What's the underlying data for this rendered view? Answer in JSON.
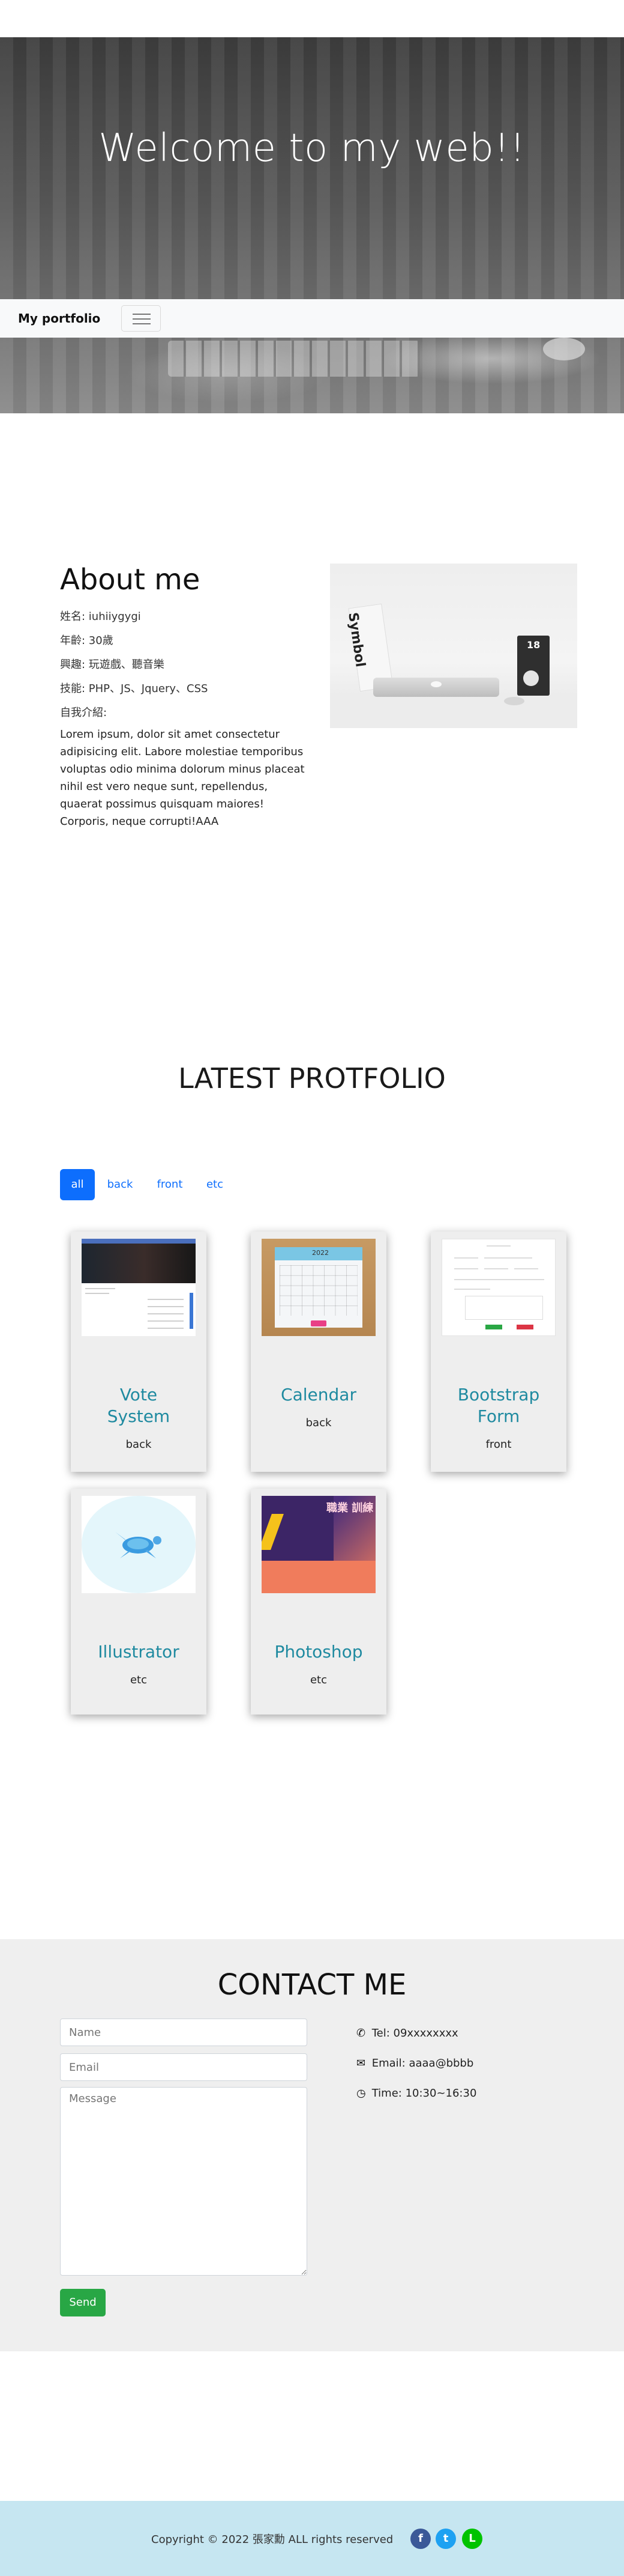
{
  "hero": {
    "title": "Welcome to my web!!"
  },
  "navbar": {
    "brand": "My portfolio"
  },
  "about": {
    "title": "About me",
    "info": [
      "姓名: iuhiiygygi",
      "年齡: 30歲",
      "興趣: 玩遊戲、聽音樂",
      "技能: PHP、JS、Jquery、CSS",
      "自我介紹:"
    ],
    "intro": "Lorem ipsum, dolor sit amet consectetur adipisicing elit. Labore molestiae temporibus voluptas odio minima dolorum minus placeat nihil est vero neque sunt, repellendus, quaerat possimus quisquam maiores! Corporis, neque corrupti!AAA",
    "photo_text_1": "Symbol",
    "photo_text_2": "18"
  },
  "portfolio": {
    "title": "LATEST PROTFOLIO",
    "filters": [
      "all",
      "back",
      "front",
      "etc"
    ],
    "active_filter": "all",
    "cards": [
      {
        "title_line1": "Vote",
        "title_line2": "System",
        "category": "back"
      },
      {
        "title_line1": "Calendar",
        "title_line2": "",
        "category": "back",
        "thumb_text": "2022"
      },
      {
        "title_line1": "Bootstrap",
        "title_line2": "Form",
        "category": "front"
      },
      {
        "title_line1": "Illustrator",
        "title_line2": "",
        "category": "etc"
      },
      {
        "title_line1": "Photoshop",
        "title_line2": "",
        "category": "etc",
        "thumb_text": "職業 訓練"
      }
    ]
  },
  "contact": {
    "title": "CONTACT ME",
    "name_placeholder": "Name",
    "email_placeholder": "Email",
    "message_placeholder": "Message",
    "send_label": "Send",
    "tel": "Tel: 09xxxxxxxx",
    "email": "Email: aaaa@bbbb",
    "time": "Time: 10:30~16:30"
  },
  "footer": {
    "copyright": "Copyright © 2022 張家勳 ALL rights reserved",
    "social": [
      {
        "icon": "facebook-icon",
        "glyph": "f",
        "color": "#3b5998"
      },
      {
        "icon": "twitter-icon",
        "glyph": "t",
        "color": "#1da1f2"
      },
      {
        "icon": "line-icon",
        "glyph": "L",
        "color": "#00c300"
      }
    ]
  },
  "colors": {
    "accent": "#0d6efd",
    "card_title": "#1f8aa0",
    "send": "#28a745",
    "footer_bg": "#c6e6f1"
  }
}
